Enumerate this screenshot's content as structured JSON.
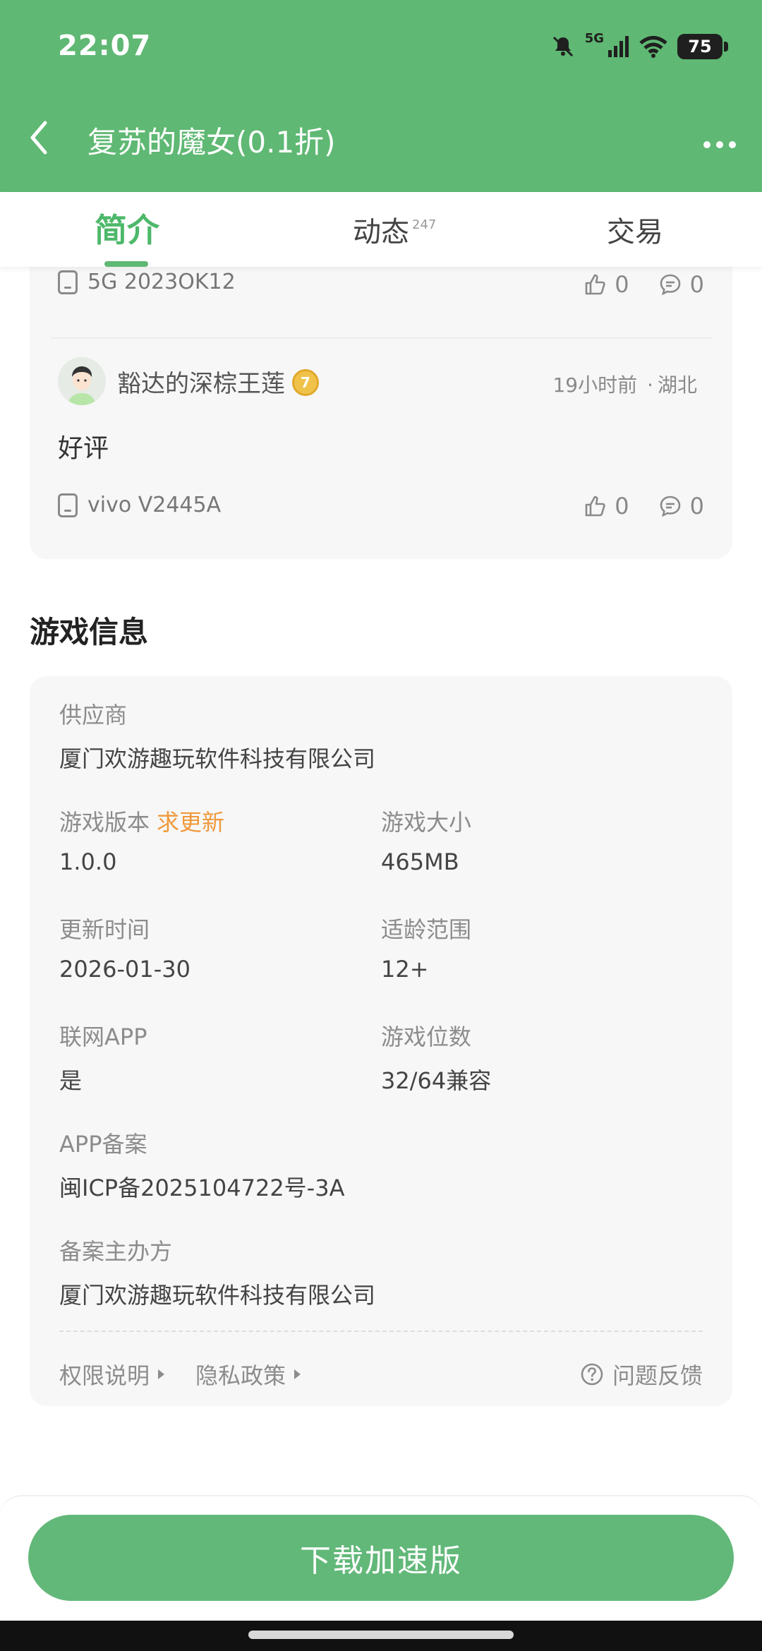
{
  "status_bar": {
    "time": "22:07",
    "network": "5G",
    "battery": "75"
  },
  "title_bar": {
    "title": "复苏的魔女(0.1折)"
  },
  "tabs": [
    {
      "label": "简介",
      "active": true
    },
    {
      "label": "动态",
      "badge": "247"
    },
    {
      "label": "交易"
    }
  ],
  "reviews": [
    {
      "device": "5G 2023OK12",
      "likes": "0",
      "comments": "0"
    },
    {
      "username": "豁达的深棕王莲",
      "level": "7",
      "time": "19小时前",
      "location": "湖北",
      "location_separator": "·",
      "text": "好评",
      "device": "vivo V2445A",
      "likes": "0",
      "comments": "0"
    }
  ],
  "game_info": {
    "title": "游戏信息",
    "supplier": {
      "label": "供应商",
      "value": "厦门欢游趣玩软件科技有限公司"
    },
    "version": {
      "label": "游戏版本",
      "link": "求更新",
      "value": "1.0.0"
    },
    "size": {
      "label": "游戏大小",
      "value": "465MB"
    },
    "update_time": {
      "label": "更新时间",
      "value": "2026-01-30"
    },
    "age_range": {
      "label": "适龄范围",
      "value": "12+"
    },
    "online_app": {
      "label": "联网APP",
      "value": "是"
    },
    "bits": {
      "label": "游戏位数",
      "value": "32/64兼容"
    },
    "app_record": {
      "label": "APP备案",
      "value": "闽ICP备2025104722号-3A"
    },
    "record_owner": {
      "label": "备案主办方",
      "value": "厦门欢游趣玩软件科技有限公司"
    },
    "footer": {
      "permissions": "权限说明",
      "privacy": "隐私政策",
      "feedback": "问题反馈"
    }
  },
  "bottom": {
    "download_label": "下载加速版"
  },
  "colors": {
    "brand_green": "#5fb873",
    "tab_active": "#4db86a",
    "link_orange": "#f0983a"
  }
}
